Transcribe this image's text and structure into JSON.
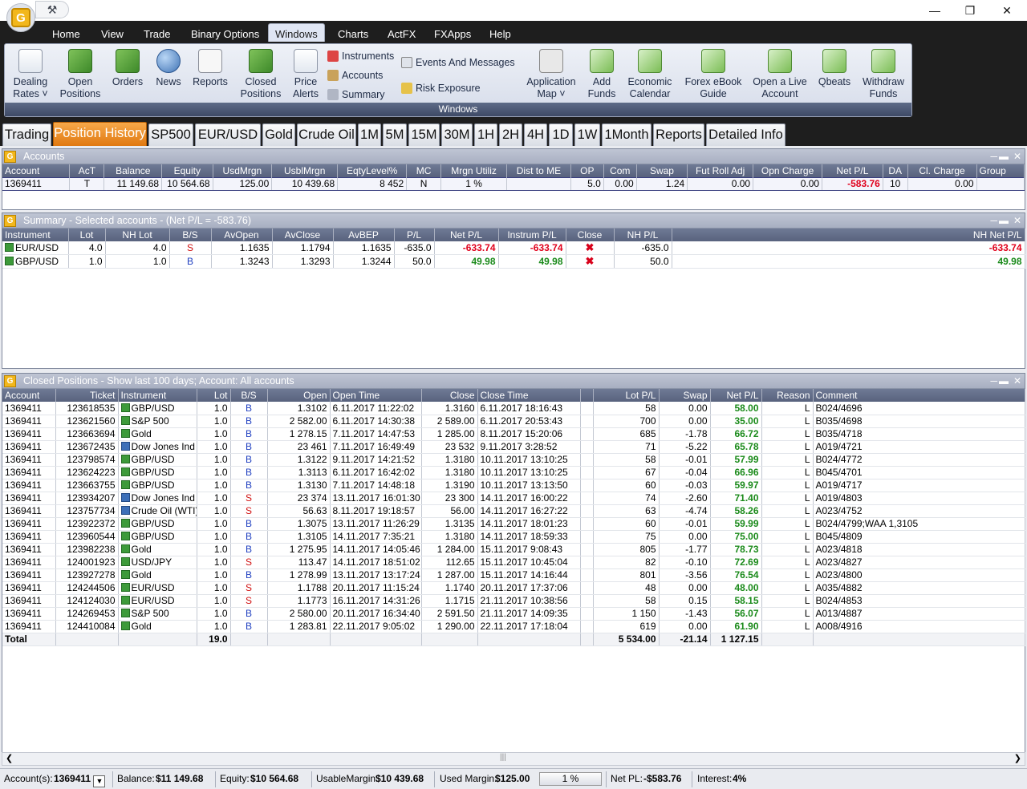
{
  "menu": [
    "Home",
    "View",
    "Trade",
    "Binary Options",
    "Windows",
    "Charts",
    "ActFX",
    "FXApps",
    "Help"
  ],
  "ribbon": {
    "group_label": "Windows",
    "dealing_rates": "Dealing\nRates ˅",
    "open_positions": "Open\nPositions",
    "orders": "Orders",
    "news": "News",
    "reports": "Reports",
    "closed_positions": "Closed\nPositions",
    "price_alerts": "Price\nAlerts",
    "instruments": "Instruments",
    "accounts": "Accounts",
    "summary": "Summary",
    "events": "Events And Messages",
    "risk": "Risk Exposure",
    "app_map": "Application\nMap ˅",
    "add_funds": "Add\nFunds",
    "econ_cal": "Economic\nCalendar",
    "ebook": "Forex eBook\nGuide",
    "live": "Open a Live\nAccount",
    "qbeats": "Qbeats",
    "withdraw": "Withdraw\nFunds"
  },
  "tabs": [
    "Trading",
    "Position History",
    "SP500",
    "EUR/USD",
    "Gold",
    "Crude Oil",
    "1M",
    "5M",
    "15M",
    "30M",
    "1H",
    "2H",
    "4H",
    "1D",
    "1W",
    "1Month",
    "Reports",
    "Detailed Info"
  ],
  "accounts_panel": {
    "title": "Accounts",
    "headers": [
      "Account",
      "AcT",
      "Balance",
      "Equity",
      "UsdMrgn",
      "UsblMrgn",
      "EqtyLevel%",
      "MC",
      "Mrgn Utiliz",
      "Dist to ME",
      "OP",
      "Com",
      "Swap",
      "Fut Roll Adj",
      "Opn Charge",
      "Net P/L",
      "DA",
      "Cl. Charge",
      "Group"
    ],
    "row": [
      "1369411",
      "T",
      "11 149.68",
      "10 564.68",
      "125.00",
      "10 439.68",
      "8 452",
      "N",
      "1 %",
      "",
      "5.0",
      "0.00",
      "1.24",
      "0.00",
      "0.00",
      "-583.76",
      "10",
      "0.00",
      ""
    ]
  },
  "summary_panel": {
    "title": "Summary - Selected accounts - (Net P/L = -583.76)",
    "headers": [
      "Instrument",
      "Lot",
      "NH Lot",
      "B/S",
      "AvOpen",
      "AvClose",
      "AvBEP",
      "P/L",
      "Net P/L",
      "Instrum P/L",
      "Close",
      "NH P/L",
      "NH Net P/L"
    ],
    "rows": [
      [
        "EUR/USD",
        "4.0",
        "4.0",
        "S",
        "1.1635",
        "1.1794",
        "1.1635",
        "-635.0",
        "-633.74",
        "-633.74",
        "✖",
        "-635.0",
        "-633.74"
      ],
      [
        "GBP/USD",
        "1.0",
        "1.0",
        "B",
        "1.3243",
        "1.3293",
        "1.3244",
        "50.0",
        "49.98",
        "49.98",
        "✖",
        "50.0",
        "49.98"
      ]
    ]
  },
  "closed_panel": {
    "title": "Closed Positions - Show last 100 days; Account: All accounts",
    "headers": [
      "Account",
      "Ticket",
      "Instrument",
      "Lot",
      "B/S",
      "Open",
      "Open Time",
      "Close",
      "Close Time",
      "",
      "Lot P/L",
      "Swap",
      "Net P/L",
      "Reason",
      "Comment"
    ],
    "rows": [
      [
        "1369411",
        "123618535",
        "GBP/USD",
        "1.0",
        "B",
        "1.3102",
        "6.11.2017 11:22:02",
        "1.3160",
        "6.11.2017 18:16:43",
        "",
        "58",
        "0.00",
        "58.00",
        "L",
        "B024/4696"
      ],
      [
        "1369411",
        "123621560",
        "S&P 500",
        "1.0",
        "B",
        "2 582.00",
        "6.11.2017 14:30:38",
        "2 589.00",
        "6.11.2017 20:53:43",
        "",
        "700",
        "0.00",
        "35.00",
        "L",
        "B035/4698"
      ],
      [
        "1369411",
        "123663694",
        "Gold",
        "1.0",
        "B",
        "1 278.15",
        "7.11.2017 14:47:53",
        "1 285.00",
        "8.11.2017 15:20:06",
        "",
        "685",
        "-1.78",
        "66.72",
        "L",
        "B035/4718"
      ],
      [
        "1369411",
        "123672435",
        "Dow Jones Ind",
        "1.0",
        "B",
        "23 461",
        "7.11.2017 16:49:49",
        "23 532",
        "9.11.2017 3:28:52",
        "",
        "71",
        "-5.22",
        "65.78",
        "L",
        "A019/4721"
      ],
      [
        "1369411",
        "123798574",
        "GBP/USD",
        "1.0",
        "B",
        "1.3122",
        "9.11.2017 14:21:52",
        "1.3180",
        "10.11.2017 13:10:25",
        "",
        "58",
        "-0.01",
        "57.99",
        "L",
        "B024/4772"
      ],
      [
        "1369411",
        "123624223",
        "GBP/USD",
        "1.0",
        "B",
        "1.3113",
        "6.11.2017 16:42:02",
        "1.3180",
        "10.11.2017 13:10:25",
        "",
        "67",
        "-0.04",
        "66.96",
        "L",
        "B045/4701"
      ],
      [
        "1369411",
        "123663755",
        "GBP/USD",
        "1.0",
        "B",
        "1.3130",
        "7.11.2017 14:48:18",
        "1.3190",
        "10.11.2017 13:13:50",
        "",
        "60",
        "-0.03",
        "59.97",
        "L",
        "A019/4717"
      ],
      [
        "1369411",
        "123934207",
        "Dow Jones Ind",
        "1.0",
        "S",
        "23 374",
        "13.11.2017 16:01:30",
        "23 300",
        "14.11.2017 16:00:22",
        "",
        "74",
        "-2.60",
        "71.40",
        "L",
        "A019/4803"
      ],
      [
        "1369411",
        "123757734",
        "Crude Oil (WTI)",
        "1.0",
        "S",
        "56.63",
        "8.11.2017 19:18:57",
        "56.00",
        "14.11.2017 16:27:22",
        "",
        "63",
        "-4.74",
        "58.26",
        "L",
        "A023/4752"
      ],
      [
        "1369411",
        "123922372",
        "GBP/USD",
        "1.0",
        "B",
        "1.3075",
        "13.11.2017 11:26:29",
        "1.3135",
        "14.11.2017 18:01:23",
        "",
        "60",
        "-0.01",
        "59.99",
        "L",
        "B024/4799;WAA 1,3105"
      ],
      [
        "1369411",
        "123960544",
        "GBP/USD",
        "1.0",
        "B",
        "1.3105",
        "14.11.2017 7:35:21",
        "1.3180",
        "14.11.2017 18:59:33",
        "",
        "75",
        "0.00",
        "75.00",
        "L",
        "B045/4809"
      ],
      [
        "1369411",
        "123982238",
        "Gold",
        "1.0",
        "B",
        "1 275.95",
        "14.11.2017 14:05:46",
        "1 284.00",
        "15.11.2017 9:08:43",
        "",
        "805",
        "-1.77",
        "78.73",
        "L",
        "A023/4818"
      ],
      [
        "1369411",
        "124001923",
        "USD/JPY",
        "1.0",
        "S",
        "113.47",
        "14.11.2017 18:51:02",
        "112.65",
        "15.11.2017 10:45:04",
        "",
        "82",
        "-0.10",
        "72.69",
        "L",
        "A023/4827"
      ],
      [
        "1369411",
        "123927278",
        "Gold",
        "1.0",
        "B",
        "1 278.99",
        "13.11.2017 13:17:24",
        "1 287.00",
        "15.11.2017 14:16:44",
        "",
        "801",
        "-3.56",
        "76.54",
        "L",
        "A023/4800"
      ],
      [
        "1369411",
        "124244506",
        "EUR/USD",
        "1.0",
        "S",
        "1.1788",
        "20.11.2017 11:15:24",
        "1.1740",
        "20.11.2017 17:37:06",
        "",
        "48",
        "0.00",
        "48.00",
        "L",
        "A035/4882"
      ],
      [
        "1369411",
        "124124030",
        "EUR/USD",
        "1.0",
        "S",
        "1.1773",
        "16.11.2017 14:31:26",
        "1.1715",
        "21.11.2017 10:38:56",
        "",
        "58",
        "0.15",
        "58.15",
        "L",
        "B024/4853"
      ],
      [
        "1369411",
        "124269453",
        "S&P 500",
        "1.0",
        "B",
        "2 580.00",
        "20.11.2017 16:34:40",
        "2 591.50",
        "21.11.2017 14:09:35",
        "",
        "1 150",
        "-1.43",
        "56.07",
        "L",
        "A013/4887"
      ],
      [
        "1369411",
        "124410084",
        "Gold",
        "1.0",
        "B",
        "1 283.81",
        "22.11.2017 9:05:02",
        "1 290.00",
        "22.11.2017 17:18:04",
        "",
        "619",
        "0.00",
        "61.90",
        "L",
        "A008/4916"
      ]
    ],
    "total": [
      "Total",
      "",
      "",
      "19.0",
      "",
      "",
      "",
      "",
      "",
      "",
      "5 534.00",
      "-21.14",
      "1 127.15",
      "",
      ""
    ]
  },
  "status": {
    "accounts_label": "Account(s):",
    "account": "1369411",
    "balance_label": "Balance:",
    "balance": "$11 149.68",
    "equity_label": "Equity:",
    "equity": "$10 564.68",
    "usable_label": "UsableMargin:",
    "usable": "$10 439.68",
    "used_label": "Used Margin:",
    "used": "$125.00",
    "util": "1 %",
    "netpl_label": "Net PL:",
    "netpl": "-$583.76",
    "interest_label": "Interest:",
    "interest": "4%"
  }
}
